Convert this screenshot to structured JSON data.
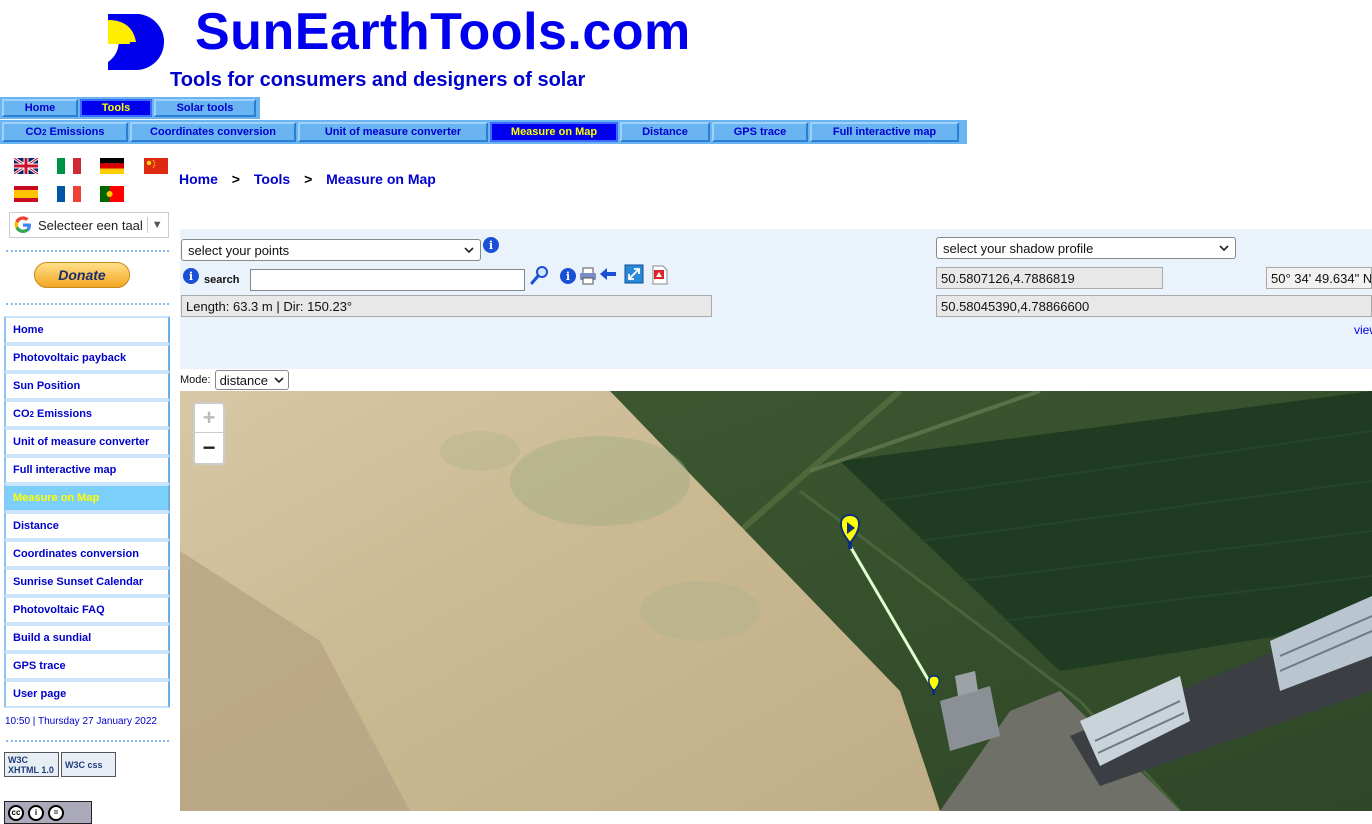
{
  "header": {
    "brand": "SunEarthTools.com",
    "tagline": "Tools for consumers and designers of solar"
  },
  "nav_primary": [
    {
      "label": "Home",
      "active": false
    },
    {
      "label": "Tools",
      "active": true
    },
    {
      "label": "Solar tools",
      "active": false
    }
  ],
  "nav_secondary": [
    {
      "label_main": "CO",
      "label_sub": "2",
      "label_tail": " Emissions",
      "active": false
    },
    {
      "label": "Coordinates conversion",
      "active": false
    },
    {
      "label": "Unit of measure converter",
      "active": false
    },
    {
      "label": "Measure on Map",
      "active": true
    },
    {
      "label": "Distance",
      "active": false
    },
    {
      "label": "GPS trace",
      "active": false
    },
    {
      "label": "Full interactive map",
      "active": false
    }
  ],
  "language_select": {
    "label": "Selecteer een taal",
    "arrow": "▼"
  },
  "donate_label": "Donate",
  "sidebar": {
    "items": [
      {
        "label": "Home"
      },
      {
        "label": "Photovoltaic payback"
      },
      {
        "label": "Sun Position"
      },
      {
        "label_main": "CO",
        "label_sub": "2",
        "label_tail": " Emissions"
      },
      {
        "label": "Unit of measure converter"
      },
      {
        "label": "Full interactive map"
      },
      {
        "label": "Measure on Map",
        "active": true
      },
      {
        "label": "Distance"
      },
      {
        "label": "Coordinates conversion"
      },
      {
        "label": "Sunrise Sunset Calendar"
      },
      {
        "label": "Photovoltaic FAQ"
      },
      {
        "label": "Build a sundial"
      },
      {
        "label": "GPS trace"
      },
      {
        "label": "User page"
      }
    ],
    "clock": "10:50 | Thursday 27 January 2022",
    "badge_xhtml": "W3C XHTML 1.0",
    "badge_css": "W3C css"
  },
  "breadcrumb": {
    "items": [
      "Home",
      "Tools",
      "Measure on Map"
    ],
    "separator": ">"
  },
  "tools": {
    "points_select": "select your points",
    "search_label": "search",
    "search_value": "",
    "length_readout": "Length: 63.3 m | Dir: 150.23°",
    "shadow_select": "select your shadow profile",
    "coord_decimal": "50.5807126,4.7886819",
    "coord_dms": "50° 34' 49.634\" N",
    "coord_precise": "50.58045390,4.78866600",
    "view_link": "view",
    "info_glyph": "i"
  },
  "mode": {
    "label": "Mode:",
    "value": "distance"
  },
  "map": {
    "zoom_in": "+",
    "zoom_out": "−",
    "line_color": "#dfffd0",
    "marker_color": "#ffff00"
  },
  "colors": {
    "brand": "#0000ee",
    "nav_bg": "#6ab4f2",
    "active_tab": "#0000ee",
    "active_text": "#ffff00"
  }
}
